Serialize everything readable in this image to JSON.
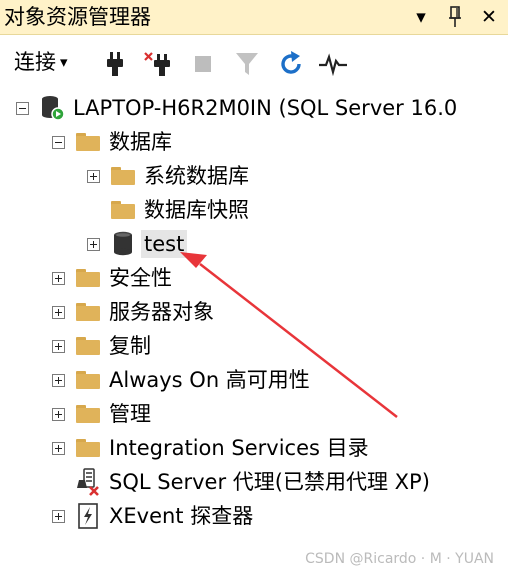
{
  "panel": {
    "title": "对象资源管理器",
    "title_buttons": {
      "dropdown": "▾",
      "pin": "ꟷ",
      "close": "✕"
    }
  },
  "toolbar": {
    "connect_label": "连接",
    "connect_caret": "▾",
    "buttons": [
      "connect-plug-icon",
      "disconnect-plug-icon",
      "stop-icon",
      "filter-icon",
      "refresh-icon",
      "activity-monitor-icon"
    ]
  },
  "tree": {
    "server": "LAPTOP-H6R2M0IN (SQL Server 16.0",
    "databases": "数据库",
    "system_databases": "系统数据库",
    "snapshots": "数据库快照",
    "test_db": "test",
    "security": "安全性",
    "server_objects": "服务器对象",
    "replication": "复制",
    "always_on": "Always On 高可用性",
    "management": "管理",
    "integration_services": "Integration Services 目录",
    "sql_agent": "SQL Server 代理(已禁用代理 XP)",
    "xevent": "XEvent 探查器"
  },
  "watermark": "CSDN @Ricardo · M · YUAN",
  "colors": {
    "title_bg": "#fff2c8",
    "folder": "#e0b35a",
    "refresh_blue": "#1c6fc8",
    "annotation_red": "#e8353a"
  }
}
